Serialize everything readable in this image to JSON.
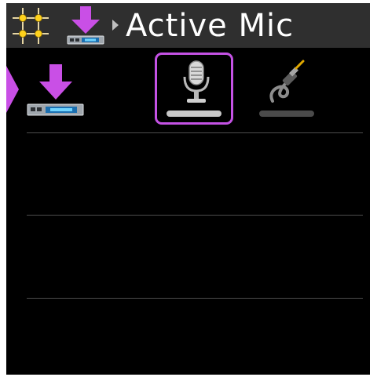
{
  "header": {
    "title": "Active Mic",
    "crosshair_icon": "crosshair-grid-icon",
    "device_icon": "device-download-icon",
    "separator_icon": "chevron-right-icon"
  },
  "colors": {
    "accent": "#c452e4",
    "header_bg": "#2f2f2f",
    "screen_bg": "#000000",
    "selected_bar": "#c8c8c8",
    "unselected_bar": "#4a4a4a"
  },
  "row": {
    "device_icon": "device-download-icon",
    "options": [
      {
        "name": "microphone",
        "icon": "microphone-icon",
        "selected": true
      },
      {
        "name": "cable",
        "icon": "audio-cable-icon",
        "selected": false
      }
    ]
  },
  "empty_rows": 3
}
